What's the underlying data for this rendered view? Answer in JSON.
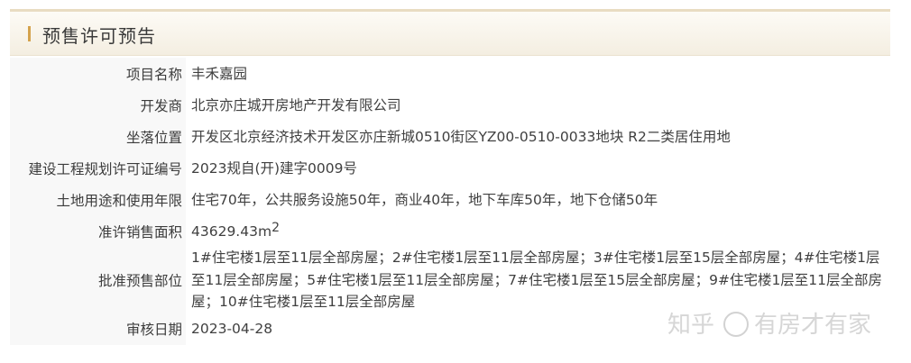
{
  "header": {
    "title": "预售许可预告"
  },
  "rows": [
    {
      "label": "项目名称",
      "value": "丰禾嘉园"
    },
    {
      "label": "开发商",
      "value": "北京亦庄城开房地产开发有限公司"
    },
    {
      "label": "坐落位置",
      "value": "开发区北京经济技术开发区亦庄新城0510街区YZ00-0510-0033地块 R2二类居住用地"
    },
    {
      "label": "建设工程规划许可证编号",
      "value": "2023规自(开)建字0009号"
    },
    {
      "label": "土地用途和使用年限",
      "value": "住宅70年，公共服务设施50年，商业40年，地下车库50年，地下仓储50年"
    },
    {
      "label": "准许销售面积",
      "value": "43629.43m",
      "unit_sup": "2"
    },
    {
      "label": "批准预售部位",
      "value": "1#住宅楼1层至11层全部房屋；2#住宅楼1层至11层全部房屋；3#住宅楼1层至15层全部房屋；4#住宅楼1层至11层全部房屋；5#住宅楼1层至11层全部房屋；7#住宅楼1层至15层全部房屋；9#住宅楼1层至11层全部房屋；10#住宅楼1层至11层全部房屋"
    },
    {
      "label": "审核日期",
      "value": "2023-04-28"
    }
  ],
  "watermark": {
    "prefix": "知乎",
    "suffix": "有房才有家"
  },
  "colors": {
    "header_bar": "#d4a24c",
    "label_bg": "#f8f8f8",
    "header_bg": "#f4eee1"
  }
}
